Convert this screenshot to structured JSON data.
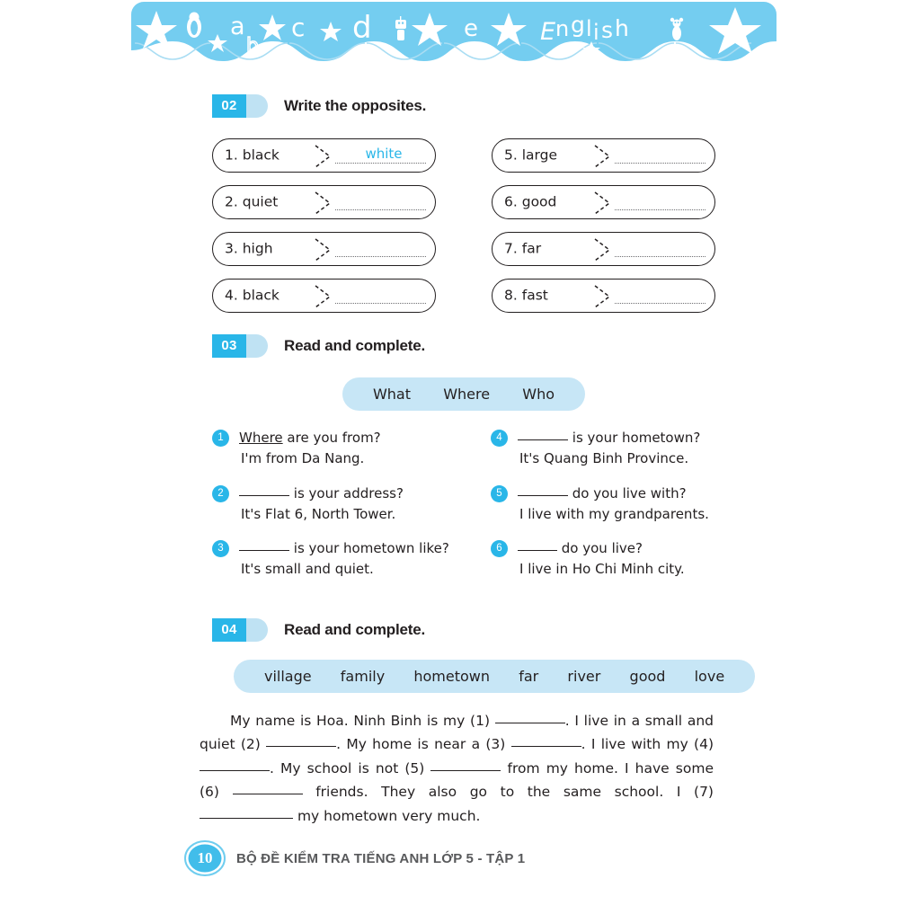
{
  "banner": {
    "title": "English",
    "letters": [
      "a",
      "b",
      "c",
      "d",
      "e"
    ],
    "colors": {
      "background": "#74cdf0",
      "foreground": "#ffffff"
    },
    "icons": [
      "star-icon",
      "penguin-icon",
      "star-icon",
      "star-icon",
      "robot-icon",
      "star-icon",
      "star-icon",
      "bear-icon",
      "star-icon"
    ]
  },
  "theme": {
    "accent": "#29b6e8",
    "accent_light": "#c7e6f6",
    "badge_tail": "#bfe2f3",
    "ink": "#231f20",
    "answer_blue": "#29b6e8",
    "footer_gray": "#58595b"
  },
  "exercise_02": {
    "number": "02",
    "title": "Write the opposites.",
    "items": [
      {
        "num": "1.",
        "word": "black",
        "answer": "white"
      },
      {
        "num": "2.",
        "word": "quiet",
        "answer": ""
      },
      {
        "num": "3.",
        "word": "high",
        "answer": ""
      },
      {
        "num": "4.",
        "word": "black",
        "answer": ""
      },
      {
        "num": "5.",
        "word": "large",
        "answer": ""
      },
      {
        "num": "6.",
        "word": "good",
        "answer": ""
      },
      {
        "num": "7.",
        "word": "far",
        "answer": ""
      },
      {
        "num": "8.",
        "word": "fast",
        "answer": ""
      }
    ]
  },
  "exercise_03": {
    "number": "03",
    "title": "Read and complete.",
    "wordbank": [
      "What",
      "Where",
      "Who"
    ],
    "items": [
      {
        "num": "1",
        "answer_filled": "Where",
        "question_tail": "are you from?",
        "answer": "I'm from Da Nang."
      },
      {
        "num": "2",
        "answer_filled": "",
        "question_tail": "is your address?",
        "answer": "It's Flat 6, North Tower."
      },
      {
        "num": "3",
        "answer_filled": "",
        "question_tail": "is your hometown like?",
        "answer": "It's small and quiet."
      },
      {
        "num": "4",
        "answer_filled": "",
        "question_tail": "is your hometown?",
        "answer": "It's Quang Binh Province."
      },
      {
        "num": "5",
        "answer_filled": "",
        "question_tail": "do you live with?",
        "answer": "I live with my grandparents."
      },
      {
        "num": "6",
        "answer_filled": "",
        "question_tail": "do you live?",
        "answer": "I live in Ho Chi Minh city."
      }
    ]
  },
  "exercise_04": {
    "number": "04",
    "title": "Read and complete.",
    "wordbank": [
      "village",
      "family",
      "hometown",
      "far",
      "river",
      "good",
      "love"
    ],
    "paragraph_parts": {
      "p0": "My name is Hoa. Ninh Binh is my (1)",
      "p1": ". I live in a small and quiet (2)",
      "p2": ". My home is near a (3)",
      "p3": ". I live with my (4)",
      "p4": ". My school is not (5)",
      "p5": "from my home. I have some (6)",
      "p6": "friends. They also go to the same school. I (7)",
      "p7": "my hometown very much."
    }
  },
  "footer": {
    "page": "10",
    "text": "BỘ ĐỀ KIỂM TRA TIẾNG ANH LỚP 5 - TẬP 1"
  }
}
